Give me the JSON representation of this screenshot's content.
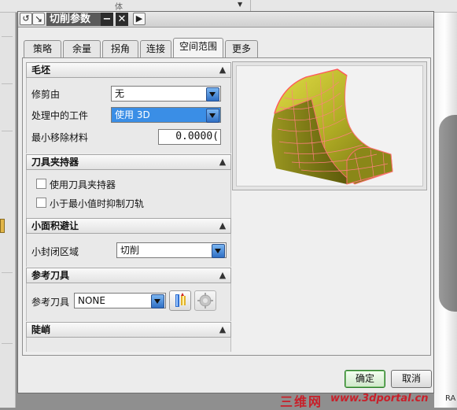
{
  "background": {
    "top_text": "体"
  },
  "dialog": {
    "title": "切削参数",
    "tabs": [
      "策略",
      "余量",
      "拐角",
      "连接",
      "空间范围",
      "更多"
    ],
    "active_tab": "空间范围"
  },
  "blank_group": {
    "title": "毛坯",
    "trim_label": "修剪由",
    "trim_value": "无",
    "ipw_label": "处理中的工件",
    "ipw_value": "使用 3D",
    "min_remove_label": "最小移除材料",
    "min_remove_value": "0.0000("
  },
  "holder_group": {
    "title": "刀具夹持器",
    "use_holder_label": "使用刀具夹持器",
    "use_holder_checked": false,
    "suppress_label": "小于最小值时抑制刀轨",
    "suppress_checked": false
  },
  "small_area_group": {
    "title": "小面积避让",
    "closed_area_label": "小封闭区域",
    "closed_area_value": "切削"
  },
  "ref_tool_group": {
    "title": "参考刀具",
    "ref_tool_label": "参考刀具",
    "ref_tool_value": "NONE"
  },
  "steep_group": {
    "title": "陡峭"
  },
  "footer": {
    "ok_label": "确定",
    "cancel_label": "取消"
  },
  "watermark": {
    "cn": "三维网",
    "url": "www.3dportal.cn",
    "tail": "RA"
  },
  "colors": {
    "highlight": "#3a8ee6",
    "model_surface": "#b8b42a",
    "model_edges": "#ff6f6f"
  }
}
